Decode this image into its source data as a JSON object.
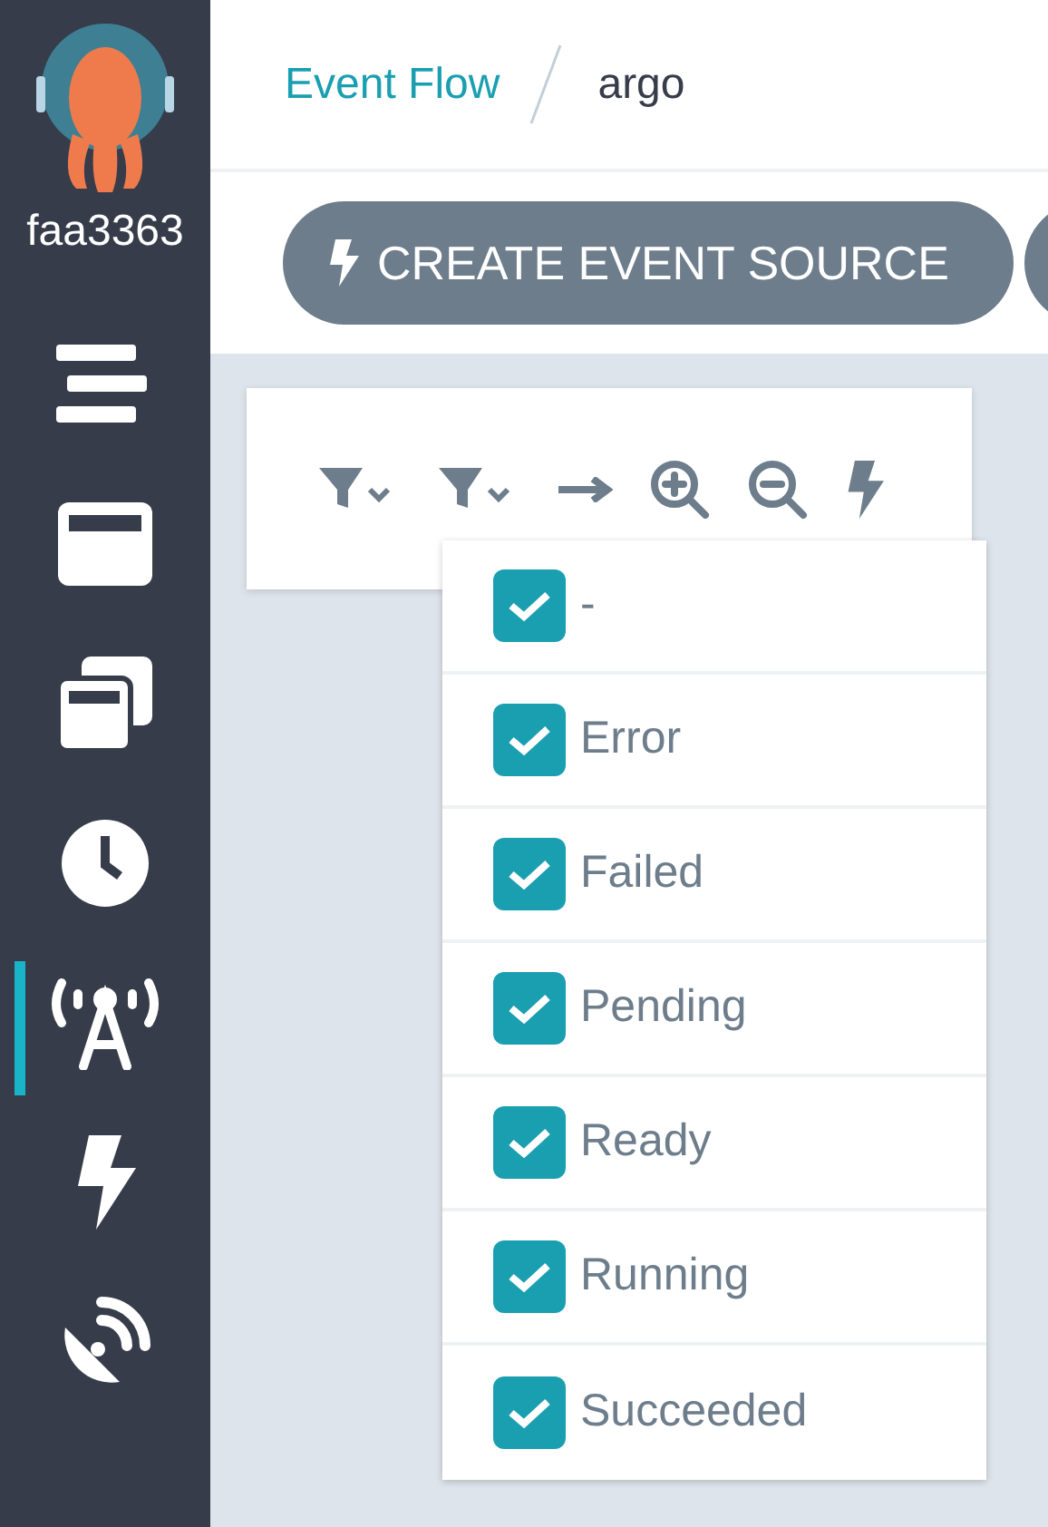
{
  "sidebar": {
    "username": "faa3363",
    "items": [
      {
        "selected": false
      },
      {
        "selected": false
      },
      {
        "selected": false
      },
      {
        "selected": false
      },
      {
        "selected": true
      },
      {
        "selected": false
      },
      {
        "selected": false
      }
    ]
  },
  "breadcrumb": [
    {
      "label": "Event Flow",
      "kind": "link"
    },
    {
      "label": "argo",
      "kind": "current"
    }
  ],
  "toolbar": {
    "buttons": [
      "CREATE EVENT SOURCE"
    ]
  },
  "filter_menu": {
    "options": [
      {
        "label": "-",
        "checked": true
      },
      {
        "label": "Error",
        "checked": true
      },
      {
        "label": "Failed",
        "checked": true
      },
      {
        "label": "Pending",
        "checked": true
      },
      {
        "label": "Ready",
        "checked": true
      },
      {
        "label": "Running",
        "checked": true
      },
      {
        "label": "Succeeded",
        "checked": true
      }
    ]
  }
}
